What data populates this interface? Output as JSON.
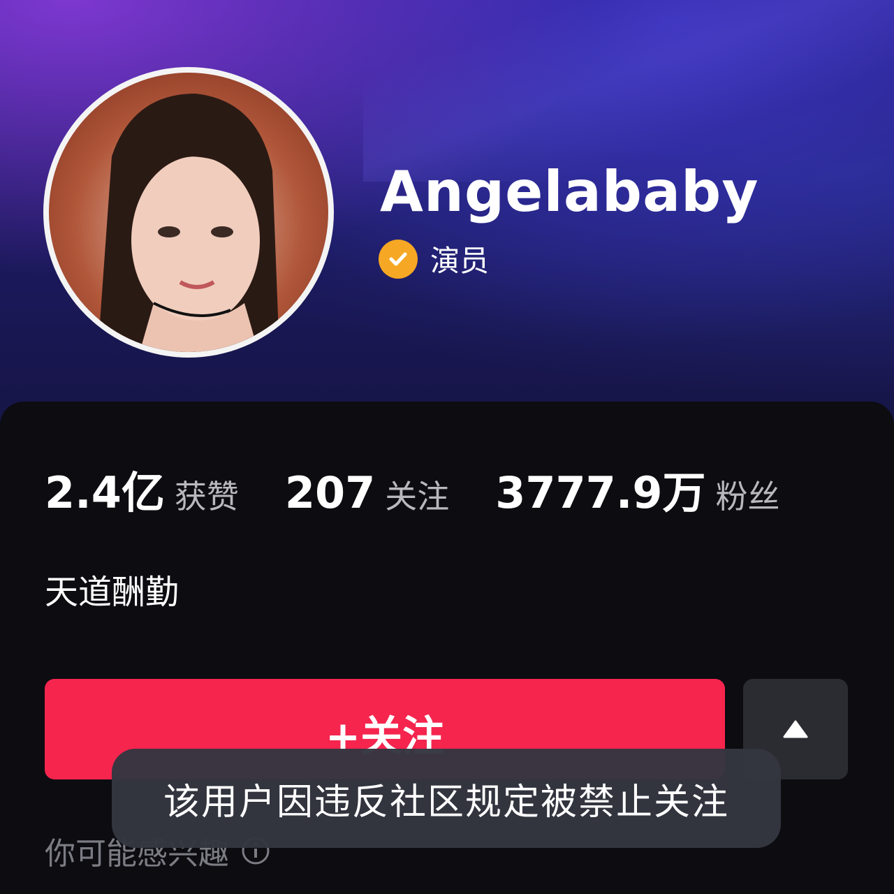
{
  "profile": {
    "name": "Angelababy",
    "verified_label": "演员",
    "bio": "天道酬勤"
  },
  "stats": [
    {
      "value": "2.4亿",
      "label": "获赞"
    },
    {
      "value": "207",
      "label": "关注"
    },
    {
      "value": "3777.9万",
      "label": "粉丝"
    }
  ],
  "actions": {
    "follow_label": "+关注",
    "more_icon": "triangle-up-icon"
  },
  "suggest": {
    "label": "你可能感兴趣",
    "icon": "info-icon"
  },
  "toast": {
    "message": "该用户因违反社区规定被禁止关注"
  },
  "colors": {
    "follow": "#f5254e",
    "verified": "#f6a723",
    "panel": "#0c0c11",
    "toast": "#34363f"
  }
}
